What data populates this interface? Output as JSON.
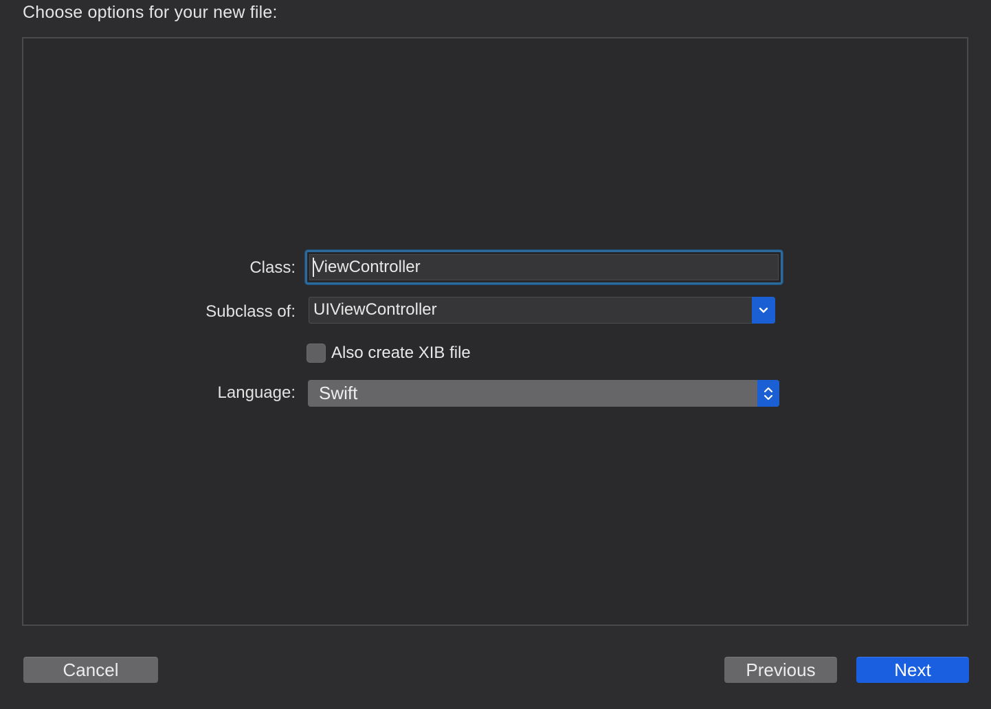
{
  "dialog": {
    "heading": "Choose options for your new file:"
  },
  "form": {
    "class_label": "Class:",
    "class_value": "ViewController",
    "subclass_label": "Subclass of:",
    "subclass_value": "UIViewController",
    "xib_checkbox_label": "Also create XIB file",
    "xib_checked": false,
    "language_label": "Language:",
    "language_value": "Swift"
  },
  "buttons": {
    "cancel": "Cancel",
    "previous": "Previous",
    "next": "Next"
  },
  "colors": {
    "background": "#2d2d2f",
    "accent": "#1a5fe0",
    "focus_ring": "#2b6a9b",
    "gray_button": "#67676a"
  },
  "icons": {
    "subclass_dropdown": "chevron-down-icon",
    "language_popup": "up-down-chevron-icon"
  }
}
